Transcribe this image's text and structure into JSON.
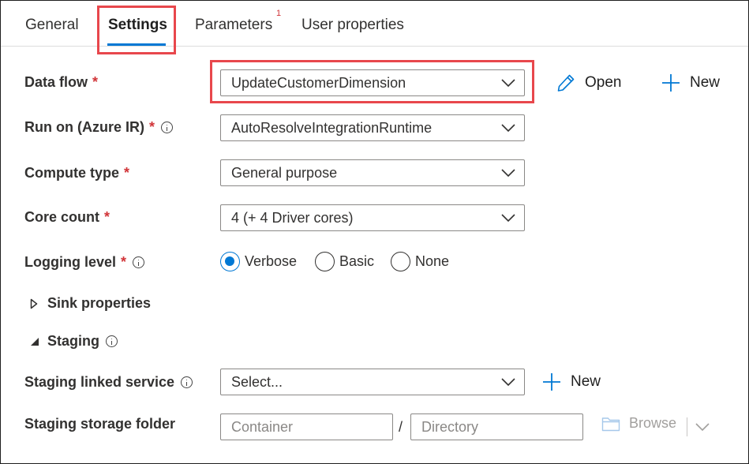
{
  "tabs": [
    {
      "label": "General"
    },
    {
      "label": "Settings"
    },
    {
      "label": "Parameters",
      "badge": "1"
    },
    {
      "label": "User properties"
    }
  ],
  "form": {
    "data_flow": {
      "label": "Data flow",
      "required_mark": "*",
      "value": "UpdateCustomerDimension",
      "open_label": "Open",
      "new_label": "New"
    },
    "run_on": {
      "label": "Run on (Azure IR)",
      "required_mark": "*",
      "value": "AutoResolveIntegrationRuntime"
    },
    "compute_type": {
      "label": "Compute type",
      "required_mark": "*",
      "value": "General purpose"
    },
    "core_count": {
      "label": "Core count",
      "required_mark": "*",
      "value": "4 (+ 4 Driver cores)"
    },
    "logging_level": {
      "label": "Logging level",
      "required_mark": "*",
      "options": [
        "Verbose",
        "Basic",
        "None"
      ],
      "selected": "Verbose"
    },
    "sink_properties": {
      "label": "Sink properties"
    },
    "staging": {
      "label": "Staging"
    },
    "staging_linked_service": {
      "label": "Staging linked service",
      "placeholder": "Select...",
      "new_label": "New"
    },
    "staging_storage_folder": {
      "label": "Staging storage folder",
      "container_placeholder": "Container",
      "separator": "/",
      "directory_placeholder": "Directory",
      "browse_label": "Browse"
    }
  },
  "colors": {
    "accent": "#0078d4",
    "highlight": "#e8474c",
    "required": "#d13438"
  }
}
